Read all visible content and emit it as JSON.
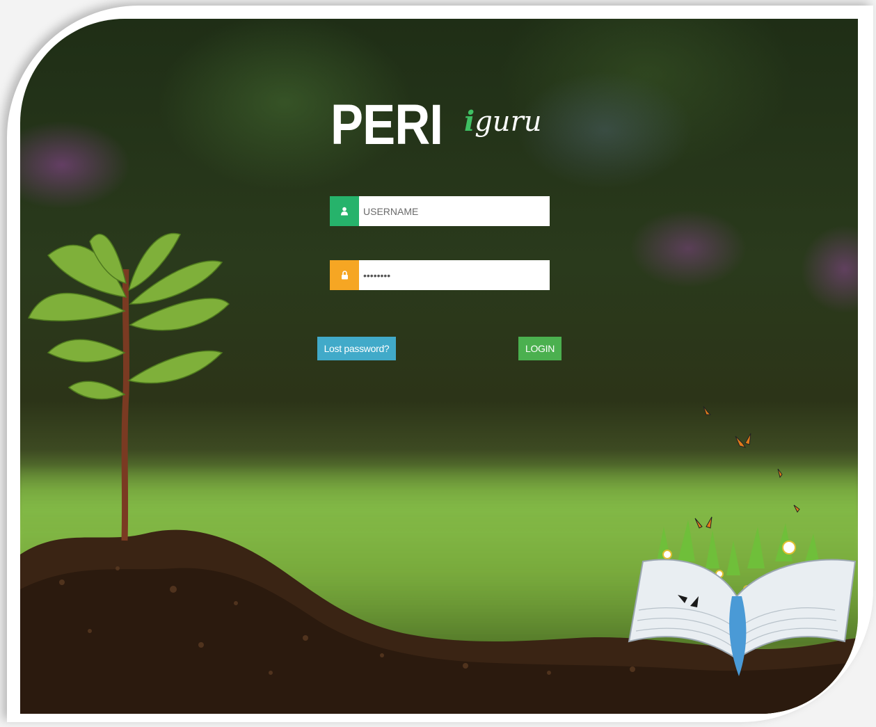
{
  "logo": {
    "brand_primary": "PERI",
    "brand_secondary_accent": "i",
    "brand_secondary_rest": "guru"
  },
  "form": {
    "username": {
      "placeholder": "USERNAME",
      "value": "",
      "icon": "user-icon"
    },
    "password": {
      "placeholder": "",
      "value": "••••••••",
      "icon": "lock-icon"
    },
    "lost_password_label": "Lost password?",
    "login_label": "LOGIN"
  },
  "colors": {
    "username_addon": "#26b36b",
    "password_addon": "#f6a623",
    "lost_password_button": "#41aac9",
    "login_button": "#4bb04f",
    "iguru_accent": "#3fbf63"
  }
}
